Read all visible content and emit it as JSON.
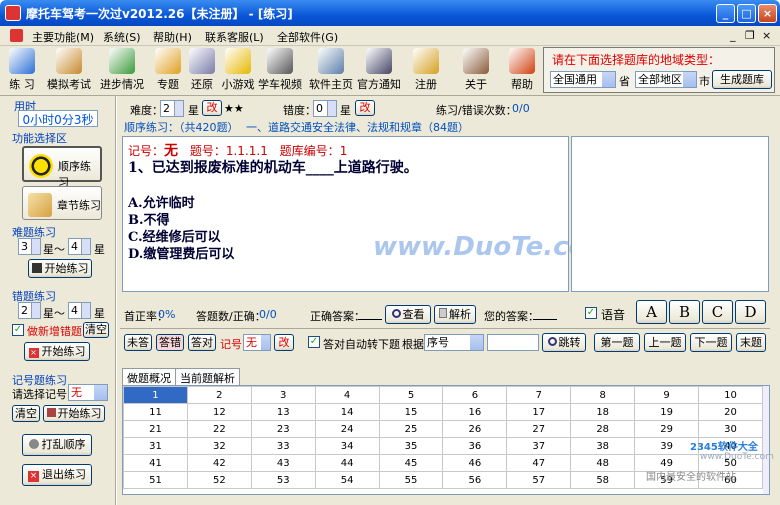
{
  "window": {
    "title": "摩托车驾考一次过v2012.26【未注册】 - [练习]",
    "min": "_",
    "max": "□",
    "close": "×"
  },
  "menu": [
    "主要功能(M)",
    "系统(S)",
    "帮助(H)",
    "联系客服(L)",
    "全部软件(G)"
  ],
  "mdi": {
    "min": "_",
    "restore": "❐",
    "close": "×"
  },
  "toolbar": [
    {
      "label": "练 习",
      "icon": "practice-icon",
      "color": "#2a6fd6"
    },
    {
      "label": "模拟考试",
      "icon": "exam-icon",
      "color": "#c68a2b"
    },
    {
      "label": "进步情况",
      "icon": "chart-icon",
      "color": "#3a9a3a"
    },
    {
      "label": "专题",
      "icon": "magnifier-icon",
      "color": "#e0a020"
    },
    {
      "label": "还原",
      "icon": "restore-icon",
      "color": "#7a7aaa"
    },
    {
      "label": "小游戏",
      "icon": "game-icon",
      "color": "#e6b800"
    },
    {
      "label": "学车视频",
      "icon": "video-icon",
      "color": "#555555"
    },
    {
      "label": "软件主页",
      "icon": "home-icon",
      "color": "#5a7fa8"
    },
    {
      "label": "官方通知",
      "icon": "notice-icon",
      "color": "#444466"
    },
    {
      "label": "注册",
      "icon": "key-icon",
      "color": "#d4a020"
    },
    {
      "label": "关于",
      "icon": "about-icon",
      "color": "#8a5a3a"
    },
    {
      "label": "帮助",
      "icon": "help-icon",
      "color": "#d04010"
    }
  ],
  "region": {
    "prompt": "请在下面选择题库的地域类型：",
    "province": "全国通用",
    "province_suffix": "省",
    "city": "全部地区",
    "city_suffix": "市",
    "generate": "生成题库"
  },
  "left": {
    "time_label": "用时",
    "time_value": "0小时0分3秒",
    "func_label": "功能选择区",
    "seq_practice": "顺序练习",
    "chapter_practice": "章节练习",
    "difficulty_label": "难题练习",
    "diff_from": "3",
    "diff_to": "4",
    "star": "星",
    "tilde": "星～",
    "start1": "开始练习",
    "wrong_label": "错题练习",
    "wrong_from": "2",
    "wrong_to": "4",
    "add_wrong": "做新增错题",
    "clear1": "清空",
    "start2": "开始练习",
    "mark_label": "记号题练习",
    "mark_choose": "请选择记号：",
    "mark_value": "无",
    "clear2": "清空",
    "start3": "开始练习",
    "shuffle": "打乱顺序",
    "exit": "退出练习"
  },
  "info": {
    "difficulty": "难度：",
    "diff_val": "2",
    "star": "星",
    "change": "改",
    "stars": "★★",
    "error_deg": "错度：",
    "err_val": "0",
    "err_star": "星",
    "change2": "改",
    "practice_count": "练习/错误次数：",
    "count_val": "0/0"
  },
  "section": {
    "mode": "顺序练习：（共420题）",
    "chapter": "一、道路交通安全法律、法规和规章（84题）"
  },
  "question": {
    "mark_label": "记号：",
    "mark_val": "无",
    "qnum_label": "题号：",
    "qnum": "1.1.1.1",
    "bank_label": "题库编号：",
    "bank": "1",
    "stem": "1、已达到报废标准的机动车____上道路行驶。",
    "options": [
      "A.允许临时",
      "B.不得",
      "C.经维修后可以",
      "D.缴管理费后可以"
    ]
  },
  "status": {
    "first_rate": "首正率：",
    "first_val": "0%",
    "answered": "答题数/正确：",
    "answered_val": "0/0",
    "correct": "正确答案：",
    "correct_val": "",
    "view": "查看",
    "explain": "解析",
    "yours": "您的答案：",
    "yours_val": "",
    "voice": "语音"
  },
  "letters": [
    "A",
    "B",
    "C",
    "D"
  ],
  "nav": {
    "unanswered": "未答",
    "wrong": "答错",
    "right": "答对",
    "mark": "记号",
    "mark_val": "无",
    "change": "改",
    "auto": "答对自动转下题",
    "by": "根据",
    "by_val": "序号",
    "jump": "跳转",
    "first": "第一题",
    "prev": "上一题",
    "next": "下一题",
    "last": "末题"
  },
  "tabs": [
    "做题概况",
    "当前题解析"
  ],
  "grid": [
    [
      "1",
      "2",
      "3",
      "4",
      "5",
      "6",
      "7",
      "8",
      "9",
      "10"
    ],
    [
      "11",
      "12",
      "13",
      "14",
      "15",
      "16",
      "17",
      "18",
      "19",
      "20"
    ],
    [
      "21",
      "22",
      "23",
      "24",
      "25",
      "26",
      "27",
      "28",
      "29",
      "30"
    ],
    [
      "31",
      "32",
      "33",
      "34",
      "35",
      "36",
      "37",
      "38",
      "39",
      "40"
    ],
    [
      "41",
      "42",
      "43",
      "44",
      "45",
      "46",
      "47",
      "48",
      "49",
      "50"
    ],
    [
      "51",
      "52",
      "53",
      "54",
      "55",
      "56",
      "57",
      "58",
      "59",
      "60"
    ]
  ],
  "watermark": {
    "duote": "www.DuoTe.com",
    "corner_brand": "2345软件大全",
    "corner_url": "www.DuoTe.com",
    "corner_tag": "国内最安全的软件站"
  }
}
